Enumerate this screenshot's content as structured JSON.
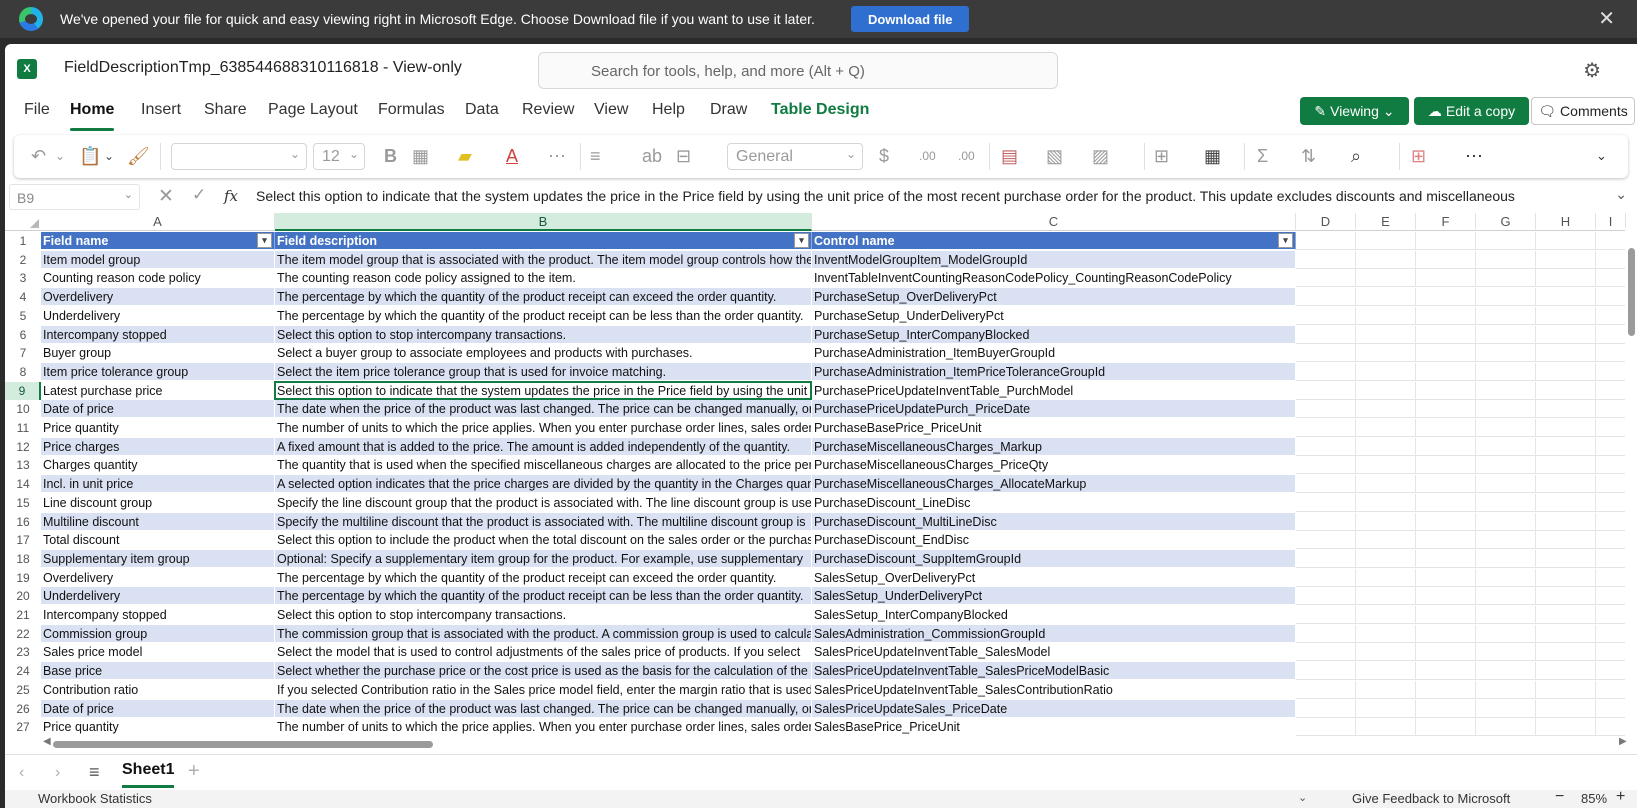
{
  "edge_banner": {
    "message": "We've opened your file for quick and easy viewing right in Microsoft Edge. Choose Download file if you want to use it later.",
    "download_label": "Download file",
    "close_icon": "✕"
  },
  "titlebar": {
    "app_icon": "X",
    "file_name": "FieldDescriptionTmp_638544688310116818  -  View-only",
    "search_placeholder": "Search for tools, help, and more (Alt + Q)",
    "settings_icon": "⚙"
  },
  "menu": {
    "tabs": [
      "File",
      "Home",
      "Insert",
      "Share",
      "Page Layout",
      "Formulas",
      "Data",
      "Review",
      "View",
      "Help",
      "Draw",
      "Table Design"
    ],
    "active_tab": "Home",
    "viewing_label": "Viewing",
    "edit_copy_label": "Edit a copy",
    "comments_label": "Comments"
  },
  "ribbon": {
    "font_size": "12",
    "number_format": "General"
  },
  "formula_bar": {
    "name_box": "B9",
    "fx": "fx",
    "content": "Select this option to indicate that the system updates the price in the Price field by using the unit price of the most recent purchase order for the product. This update excludes discounts and miscellaneous"
  },
  "grid": {
    "column_headers": [
      "A",
      "B",
      "C",
      "D",
      "E",
      "F",
      "G",
      "H",
      "I"
    ],
    "selected_column": "B",
    "selected_row": "9",
    "table_headers": [
      "Field name",
      "Field description",
      "Control name"
    ],
    "row_numbers": [
      "1",
      "2",
      "3",
      "4",
      "5",
      "6",
      "7",
      "8",
      "9",
      "10",
      "11",
      "12",
      "13",
      "14",
      "15",
      "16",
      "17",
      "18",
      "19",
      "20",
      "21",
      "22",
      "23",
      "24",
      "25",
      "26",
      "27"
    ],
    "rows": [
      [
        "Item model group",
        "The item model group that is associated with the product. The item model group controls how the",
        "InventModelGroupItem_ModelGroupId"
      ],
      [
        "Counting reason code policy",
        "The counting reason code policy assigned to the item.",
        "InventTableInventCountingReasonCodePolicy_CountingReasonCodePolicy"
      ],
      [
        "Overdelivery",
        "The percentage by which the quantity of the product receipt can exceed the order quantity.",
        "PurchaseSetup_OverDeliveryPct"
      ],
      [
        "Underdelivery",
        "The percentage by which the quantity of the product receipt can be less than the order quantity.",
        "PurchaseSetup_UnderDeliveryPct"
      ],
      [
        "Intercompany stopped",
        "Select this option to stop intercompany transactions.",
        "PurchaseSetup_InterCompanyBlocked"
      ],
      [
        "Buyer group",
        "Select a buyer group to associate employees and products with purchases.",
        "PurchaseAdministration_ItemBuyerGroupId"
      ],
      [
        "Item price tolerance group",
        "Select the item price tolerance group that is used for invoice matching.",
        "PurchaseAdministration_ItemPriceToleranceGroupId"
      ],
      [
        "Latest purchase price",
        "Select this option to indicate that the system updates the price in the Price field by using the unit",
        "PurchasePriceUpdateInventTable_PurchModel"
      ],
      [
        "Date of price",
        "The date when the price of the product was last changed. The price can be changed manually, or",
        "PurchasePriceUpdatePurch_PriceDate"
      ],
      [
        "Price quantity",
        "The number of units to which the price applies. When you enter purchase order lines, sales order",
        "PurchaseBasePrice_PriceUnit"
      ],
      [
        "Price charges",
        "A fixed amount that is added to the price. The amount is added independently of the quantity.",
        "PurchaseMiscellaneousCharges_Markup"
      ],
      [
        "Charges quantity",
        "The quantity that is used when the specified miscellaneous charges are allocated to the price per",
        "PurchaseMiscellaneousCharges_PriceQty"
      ],
      [
        "Incl. in unit price",
        "A selected option indicates that the price charges are divided by the quantity in the Charges quantity",
        "PurchaseMiscellaneousCharges_AllocateMarkup"
      ],
      [
        "Line discount group",
        "Specify the line discount group that the product is associated with. The line discount group is used",
        "PurchaseDiscount_LineDisc"
      ],
      [
        "Multiline discount",
        "Specify the multiline discount that the product is associated with. The multiline discount group is",
        "PurchaseDiscount_MultiLineDisc"
      ],
      [
        "Total discount",
        "Select this option to include the product when the total discount on the sales order or the purchase",
        "PurchaseDiscount_EndDisc"
      ],
      [
        "Supplementary item group",
        "Optional: Specify a supplementary item group for the product. For example, use supplementary",
        "PurchaseDiscount_SuppItemGroupId"
      ],
      [
        "Overdelivery",
        "The percentage by which the quantity of the product receipt can exceed the order quantity.",
        "SalesSetup_OverDeliveryPct"
      ],
      [
        "Underdelivery",
        "The percentage by which the quantity of the product receipt can be less than the order quantity.",
        "SalesSetup_UnderDeliveryPct"
      ],
      [
        "Intercompany stopped",
        "Select this option to stop intercompany transactions.",
        "SalesSetup_InterCompanyBlocked"
      ],
      [
        "Commission group",
        "The commission group that is associated with the product. A commission group is used to calculate",
        "SalesAdministration_CommissionGroupId"
      ],
      [
        "Sales price model",
        "Select the model that is used to control adjustments of the sales price of products. If you select",
        "SalesPriceUpdateInventTable_SalesModel"
      ],
      [
        "Base price",
        "Select whether the purchase price or the cost price is used as the basis for the calculation of the",
        "SalesPriceUpdateInventTable_SalesPriceModelBasic"
      ],
      [
        "Contribution ratio",
        "If you selected Contribution ratio in the Sales price model field, enter the margin ratio that is used",
        "SalesPriceUpdateInventTable_SalesContributionRatio"
      ],
      [
        "Date of price",
        "The date when the price of the product was last changed. The price can be changed manually, or",
        "SalesPriceUpdateSales_PriceDate"
      ],
      [
        "Price quantity",
        "The number of units to which the price applies. When you enter purchase order lines, sales order",
        "SalesBasePrice_PriceUnit"
      ]
    ]
  },
  "sheets": {
    "active": "Sheet1"
  },
  "status": {
    "workbook_statistics": "Workbook Statistics",
    "feedback": "Give Feedback to Microsoft",
    "zoom": "85%"
  },
  "colors": {
    "excel_green": "#107c41",
    "table_header": "#4472c4",
    "band": "#d9e1f2",
    "edge_button": "#2f6fcf"
  }
}
